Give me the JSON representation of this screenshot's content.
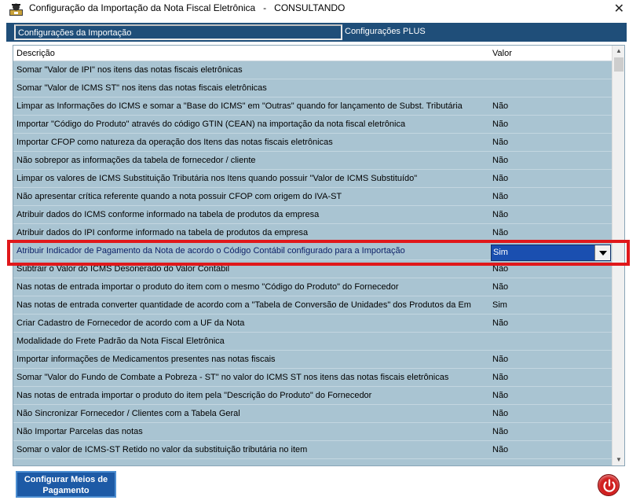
{
  "window": {
    "title": "Configuração da Importação da Nota Fiscal Eletrônica   -   CONSULTANDO",
    "close_glyph": "✕",
    "icon": "app-icon"
  },
  "tabs": [
    {
      "label": "Configurações da Importação",
      "active": true
    },
    {
      "label": "Configurações PLUS",
      "active": false
    }
  ],
  "grid": {
    "columns": [
      "Descrição",
      "Valor"
    ],
    "rows": [
      {
        "descricao": "Somar \"Valor de IPI\" nos itens das notas fiscais eletrônicas",
        "valor": ""
      },
      {
        "descricao": "Somar \"Valor de ICMS ST\" nos itens das notas fiscais eletrônicas",
        "valor": ""
      },
      {
        "descricao": "Limpar as Informações do ICMS e somar a \"Base do ICMS\" em \"Outras\" quando for lançamento de Subst. Tributária",
        "valor": "Não"
      },
      {
        "descricao": "Importar \"Código do Produto\" através do código GTIN (CEAN) na importação da nota fiscal eletrônica",
        "valor": "Não"
      },
      {
        "descricao": "Importar CFOP como natureza da operação dos Itens das notas fiscais eletrônicas",
        "valor": "Não"
      },
      {
        "descricao": "Não sobrepor as informações da tabela de fornecedor / cliente",
        "valor": "Não"
      },
      {
        "descricao": "Limpar os valores de ICMS Substituição Tributária nos Itens quando possuir \"Valor de ICMS Substituído\"",
        "valor": "Não"
      },
      {
        "descricao": "Não apresentar crítica referente quando a nota possuir CFOP com origem do IVA-ST",
        "valor": "Não"
      },
      {
        "descricao": "Atribuir dados do ICMS conforme informado na tabela de produtos da empresa",
        "valor": "Não"
      },
      {
        "descricao": "Atribuir dados do IPI conforme informado na tabela de produtos da empresa",
        "valor": "Não"
      },
      {
        "descricao": "Atribuir Indicador de Pagamento da Nota de acordo o Código Contábil configurado para a Importação",
        "valor": "Sim",
        "selected": true
      },
      {
        "descricao": "Subtrair o Valor do ICMS Desonerado do Valor Contábil",
        "valor": "Não"
      },
      {
        "descricao": "Nas notas de entrada importar o produto do item com o mesmo \"Código do Produto\" do Fornecedor",
        "valor": "Não"
      },
      {
        "descricao": "Nas notas de entrada converter quantidade de acordo com a \"Tabela de Conversão de Unidades\" dos Produtos da Em",
        "valor": "Sim"
      },
      {
        "descricao": "Criar Cadastro de Fornecedor de acordo com a UF da Nota",
        "valor": "Não"
      },
      {
        "descricao": "Modalidade do Frete Padrão da Nota Fiscal Eletrônica",
        "valor": ""
      },
      {
        "descricao": "Importar informações de Medicamentos presentes nas notas fiscais",
        "valor": "Não"
      },
      {
        "descricao": "Somar \"Valor do Fundo de Combate a Pobreza - ST\" no valor do ICMS ST nos itens das notas fiscais eletrônicas",
        "valor": "Não"
      },
      {
        "descricao": "Nas notas de entrada importar o produto do item pela \"Descrição do Produto\" do Fornecedor",
        "valor": "Não"
      },
      {
        "descricao": "Não Sincronizar Fornecedor / Clientes com a Tabela Geral",
        "valor": "Não"
      },
      {
        "descricao": "Não Importar Parcelas das notas",
        "valor": "Não"
      },
      {
        "descricao": "Somar o valor de ICMS-ST Retido no valor da substituição tributária no item",
        "valor": "Não"
      }
    ],
    "editor": {
      "value": "Sim",
      "options_visible": [
        "Sim"
      ]
    }
  },
  "footer": {
    "config_button_line1": "Configurar Meios de",
    "config_button_line2": "Pagamento",
    "exit_icon": "power-icon"
  },
  "colors": {
    "grid_bg": "#a9c4d2",
    "tab_bg": "#1f4e79",
    "highlight": "#e0181b",
    "button_bg": "#1d5aa6",
    "exit_red": "#d11f1f"
  }
}
